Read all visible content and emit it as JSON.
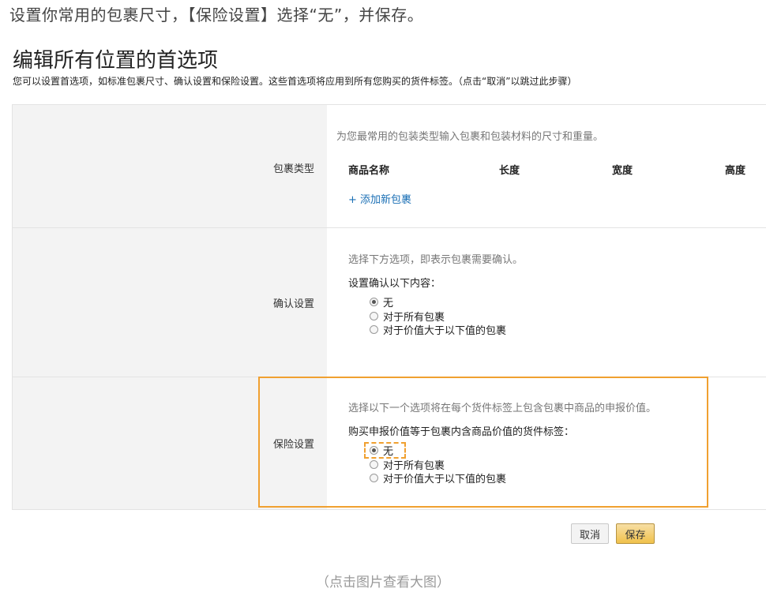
{
  "instruction": "设置你常用的包裹尺寸，【保险设置】选择“无”，并保存。",
  "page": {
    "title": "编辑所有位置的首选项",
    "description": "您可以设置首选项，如标准包裹尺寸、确认设置和保险设置。这些首选项将应用到所有您购买的货件标签。（点击“取消”以跳过此步骤）"
  },
  "package_section": {
    "label": "包裹类型",
    "hint": "为您最常用的包装类型输入包裹和包装材料的尺寸和重量。",
    "columns": [
      "商品名称",
      "长度",
      "宽度",
      "高度"
    ],
    "add_link": "+ 添加新包裹"
  },
  "confirm_section": {
    "label": "确认设置",
    "hint": "选择下方选项，即表示包裹需要确认。",
    "sub_label": "设置确认以下内容：",
    "options": [
      "无",
      "对于所有包裹",
      "对于价值大于以下值的包裹"
    ],
    "selected": "无"
  },
  "insurance_section": {
    "label": "保险设置",
    "hint": "选择以下一个选项将在每个货件标签上包含包裹中商品的申报价值。",
    "sub_label": "购买申报价值等于包裹内含商品价值的货件标签：",
    "options": [
      "无",
      "对于所有包裹",
      "对于价值大于以下值的包裹"
    ],
    "selected": "无"
  },
  "buttons": {
    "cancel": "取消",
    "save": "保存"
  },
  "caption": "（点击图片查看大图）",
  "colors": {
    "highlight": "#f0a030",
    "link": "#1a6fb5",
    "save_button": "#f0c14b"
  }
}
